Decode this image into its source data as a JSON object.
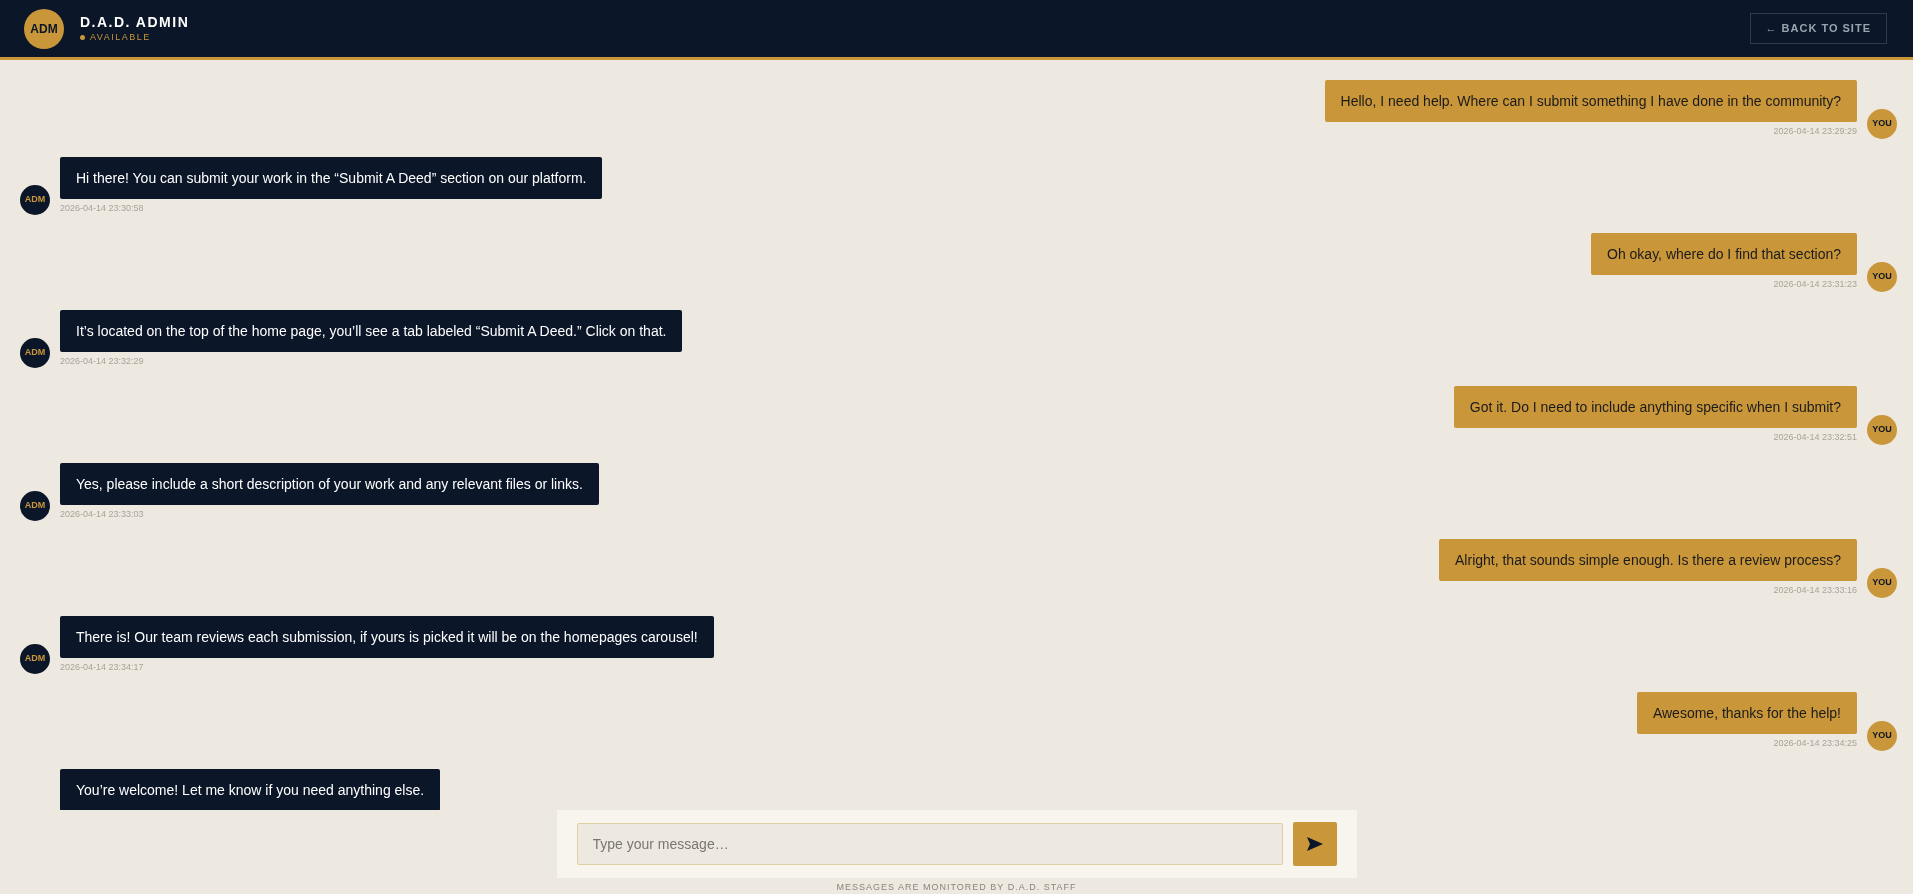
{
  "header": {
    "avatar": "ADM",
    "title": "D.A.D. ADMIN",
    "status": "AVAILABLE",
    "back_button": "← BACK TO SITE"
  },
  "messages": [
    {
      "kind": "user",
      "avatar": "YOU",
      "text": "Hello, I need help. Where can I submit something I have done in the community?",
      "time": "2026-04-14 23:29:29"
    },
    {
      "kind": "admin",
      "avatar": "ADM",
      "text": "Hi there! You can submit your work in the “Submit A Deed” section on our platform.",
      "time": "2026-04-14 23:30:58"
    },
    {
      "kind": "user",
      "avatar": "YOU",
      "text": "Oh okay, where do I find that section?",
      "time": "2026-04-14 23:31:23"
    },
    {
      "kind": "admin",
      "avatar": "ADM",
      "text": "It’s located on the top of the home page, you’ll see a tab labeled “Submit A Deed.” Click on that.",
      "time": "2026-04-14 23:32:29"
    },
    {
      "kind": "user",
      "avatar": "YOU",
      "text": "Got it. Do I need to include anything specific when I submit?",
      "time": "2026-04-14 23:32:51"
    },
    {
      "kind": "admin",
      "avatar": "ADM",
      "text": "Yes, please include a short description of your work and any relevant files or links.",
      "time": "2026-04-14 23:33:03"
    },
    {
      "kind": "user",
      "avatar": "YOU",
      "text": "Alright, that sounds simple enough. Is there a review process?",
      "time": "2026-04-14 23:33:16"
    },
    {
      "kind": "admin",
      "avatar": "ADM",
      "text": "There is! Our team reviews each submission, if yours is picked it will be on the homepages carousel!",
      "time": "2026-04-14 23:34:17"
    },
    {
      "kind": "user",
      "avatar": "YOU",
      "text": "Awesome, thanks for the help!",
      "time": "2026-04-14 23:34:25"
    },
    {
      "kind": "admin",
      "text": "You’re welcome! Let me know if you need anything else."
    }
  ],
  "composer": {
    "placeholder": "Type your message…"
  },
  "footer": "MESSAGES ARE MONITORED BY D.A.D. STAFF"
}
